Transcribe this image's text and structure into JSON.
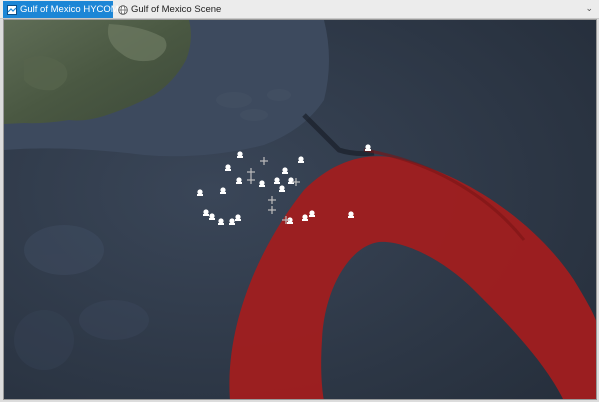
{
  "tabs": [
    {
      "label": "Gulf of Mexico HYCOM",
      "icon": "map-icon",
      "active": true
    },
    {
      "label": "Gulf of Mexico Scene",
      "icon": "globe-scene-icon",
      "active": false
    }
  ],
  "map": {
    "current_color": "#a11d1f",
    "ocean_color": "#2f3a4a",
    "land_color": "#4b5a43",
    "buoy_icon": "buoy-marker-icon",
    "station_icon": "crosshair-marker-icon"
  }
}
